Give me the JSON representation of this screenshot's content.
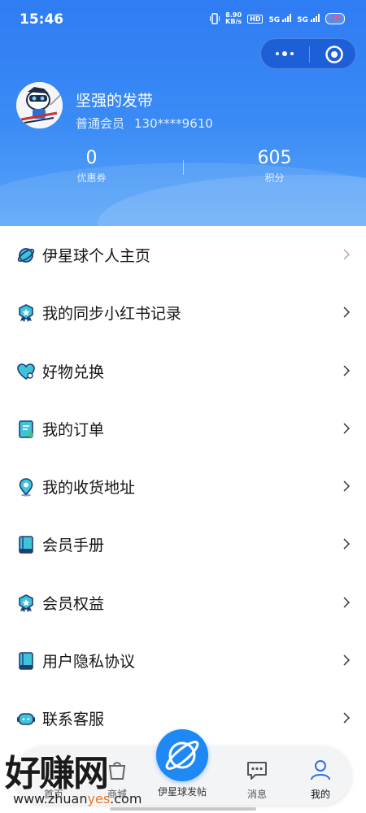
{
  "status_bar": {
    "time": "15:46",
    "net_speed_value": "8.90",
    "net_speed_unit": "KB/s",
    "hd": "HD",
    "sim1": "5G",
    "sim2": "5G",
    "battery": "28"
  },
  "capsule": {
    "more_icon": "more-dots-icon",
    "close_icon": "target-close-icon"
  },
  "profile": {
    "username": "坚强的发带",
    "level": "普通会员",
    "phone": "130****9610",
    "coupons_value": "0",
    "coupons_label": "优惠券",
    "points_value": "605",
    "points_label": "积分"
  },
  "menu": [
    {
      "label": "伊星球个人主页",
      "icon": "planet-icon"
    },
    {
      "label": "我的同步小红书记录",
      "icon": "badge-star-icon"
    },
    {
      "label": "好物兑换",
      "icon": "heart-icon"
    },
    {
      "label": "我的订单",
      "icon": "order-doc-icon"
    },
    {
      "label": "我的收货地址",
      "icon": "location-pin-icon"
    },
    {
      "label": "会员手册",
      "icon": "book-icon"
    },
    {
      "label": "会员权益",
      "icon": "badge-star-icon"
    },
    {
      "label": "用户隐私协议",
      "icon": "book-icon"
    },
    {
      "label": "联系客服",
      "icon": "headset-icon"
    }
  ],
  "tabbar": {
    "home": "首页",
    "shop": "商城",
    "post": "伊星球发帖",
    "messages": "消息",
    "mine": "我的"
  },
  "watermark": {
    "big_text": "好赚网",
    "url_prefix": "www.zhuan",
    "url_highlight": "yes",
    "url_suffix": ".com"
  },
  "colors": {
    "primary": "#2f7cf3",
    "accent": "#1e88f5",
    "icon_teal": "#3fc3d8"
  }
}
